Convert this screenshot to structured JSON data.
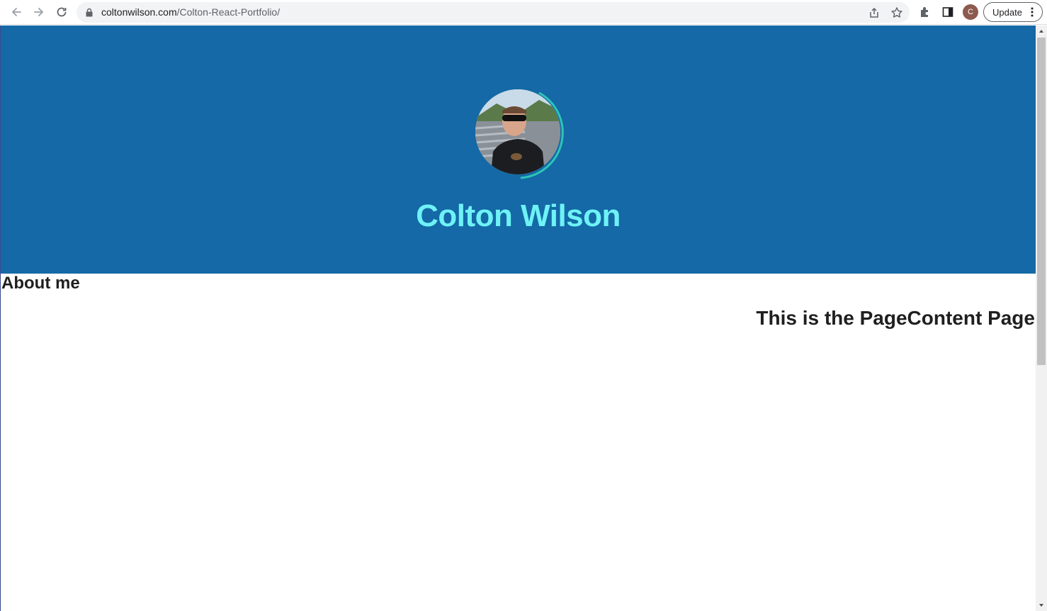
{
  "browser": {
    "url_domain": "coltonwilson.com",
    "url_path": "/Colton-React-Portfolio/",
    "profile_initial": "C",
    "update_label": "Update"
  },
  "header": {
    "name": "Colton Wilson"
  },
  "main": {
    "section_title": "About me",
    "page_content_text": "This is the PageContent Page"
  },
  "colors": {
    "header_bg": "#1469a6",
    "name_color": "#6ef2f6",
    "ring_color": "#2ec4b6"
  },
  "icons": [
    "back-icon",
    "forward-icon",
    "reload-icon",
    "lock-icon",
    "share-icon",
    "star-icon",
    "extensions-icon",
    "side-panel-icon",
    "menu-dots-icon"
  ]
}
